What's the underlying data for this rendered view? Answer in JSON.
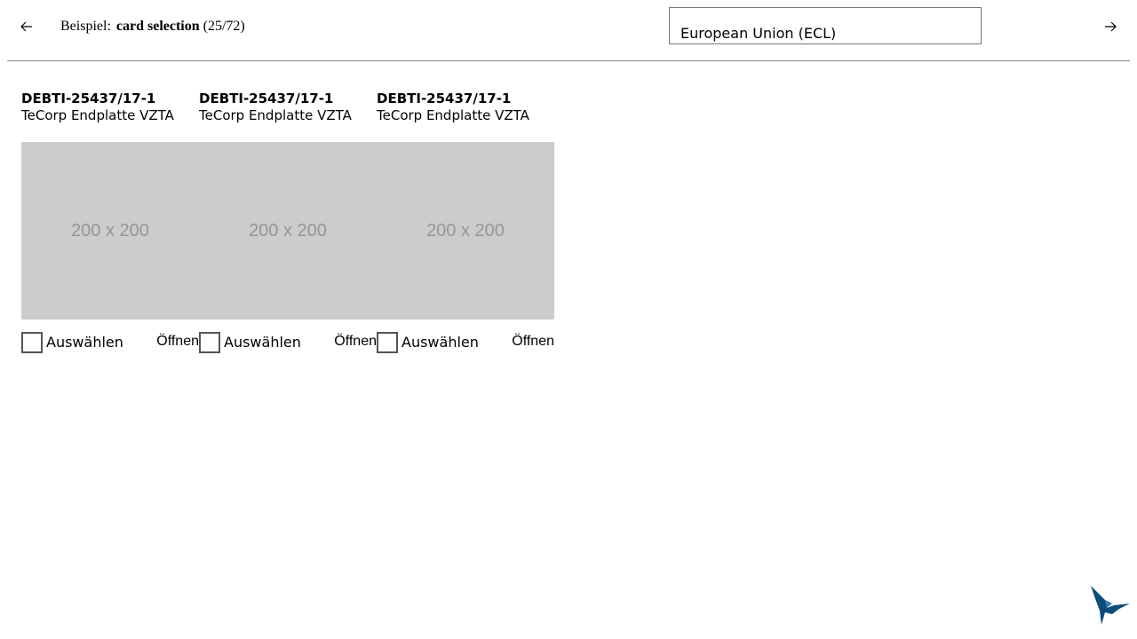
{
  "header": {
    "prev_icon": "arrow-left-icon",
    "next_icon": "arrow-right-icon",
    "prefix": "Beispiel:",
    "title": "card selection",
    "counter": "(25/72)"
  },
  "language_select": {
    "selected": "European Union (ECL)"
  },
  "cards": [
    {
      "title": "DEBTI-25437/17-1",
      "subtitle": "TeCorp Endplatte VZTA",
      "image_text": "200 x 200",
      "select_label": "Auswählen",
      "open_label": "Öffnen",
      "checked": false
    },
    {
      "title": "DEBTI-25437/17-1",
      "subtitle": "TeCorp Endplatte VZTA",
      "image_text": "200 x 200",
      "select_label": "Auswählen",
      "open_label": "Öffnen",
      "checked": false
    },
    {
      "title": "DEBTI-25437/17-1",
      "subtitle": "TeCorp Endplatte VZTA",
      "image_text": "200 x 200",
      "select_label": "Auswählen",
      "open_label": "Öffnen",
      "checked": false
    }
  ],
  "colors": {
    "logo": "#0e4c7a",
    "placeholder_bg": "#cccccc",
    "placeholder_text": "#969696"
  },
  "logo_icon": "hummingbird-logo-icon"
}
